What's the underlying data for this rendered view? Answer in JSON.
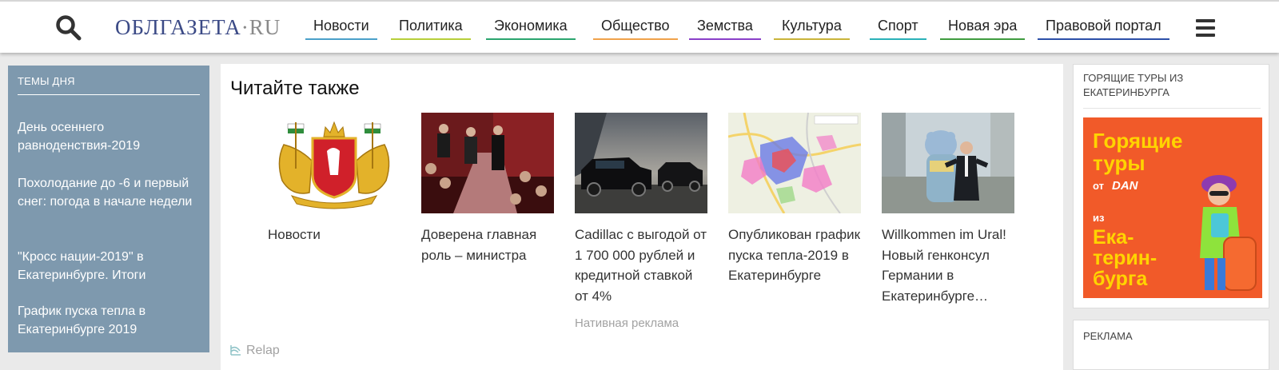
{
  "header": {
    "logo_main": "ОБЛГАЗЕТА",
    "logo_dot": "•",
    "logo_tld": "RU",
    "search_icon": "search-icon",
    "menu_icon": "hamburger-menu-icon",
    "nav": [
      {
        "label": "Новости",
        "color": "#4aa0c9"
      },
      {
        "label": "Политика",
        "color": "#b7cf3a"
      },
      {
        "label": "Экономика",
        "color": "#2ba56f"
      },
      {
        "label": "Общество",
        "color": "#f0a24a"
      },
      {
        "label": "Земства",
        "color": "#8a3fc8"
      },
      {
        "label": "Культура",
        "color": "#c9b43a"
      },
      {
        "label": "Спорт",
        "color": "#2ab1b8"
      },
      {
        "label": "Новая эра",
        "color": "#3f9c3f"
      },
      {
        "label": "Правовой портал",
        "color": "#2c4fa8"
      }
    ]
  },
  "themes": {
    "title": "ТЕМЫ ДНЯ",
    "items": [
      "День осеннего равноденствия-2019",
      "Похолодание до -6 и первый снег: погода в начале недели",
      "\"Кросс нации-2019\" в Екатеринбурге. Итоги",
      "График пуска тепла в Екатеринбурге 2019"
    ]
  },
  "main": {
    "title": "Читайте также",
    "cards": [
      {
        "caption": "Новости",
        "image": "coat-of-arms-image"
      },
      {
        "caption": "Доверена главная роль – министра",
        "image": "theater-audience-image"
      },
      {
        "caption": "Cadillac с выгодой от 1 700 000 рублей и кредитной ставкой от 4%",
        "image": "cadillac-suvs-image"
      },
      {
        "caption": "Опубликован график пуска тепла-2019 в Екатеринбурге",
        "image": "city-map-image"
      },
      {
        "caption": "Willkommen im Ural! Новый генконсул Германии в Екатеринбурге…",
        "image": "consul-bear-image"
      }
    ],
    "native_ad": "Нативная реклама",
    "relap": "Relap"
  },
  "right": {
    "tours_title": "ГОРЯЩИЕ ТУРЫ ИЗ ЕКАТЕРИНБУРГА",
    "banner": {
      "line1": "Горящие",
      "line2": "туры",
      "from": "от",
      "brand": "DAN",
      "iz": "из",
      "city1": "Ека-",
      "city2": "терин-",
      "city3": "бурга",
      "bg": "#f15a29"
    },
    "ads_title": "РЕКЛАМА"
  }
}
